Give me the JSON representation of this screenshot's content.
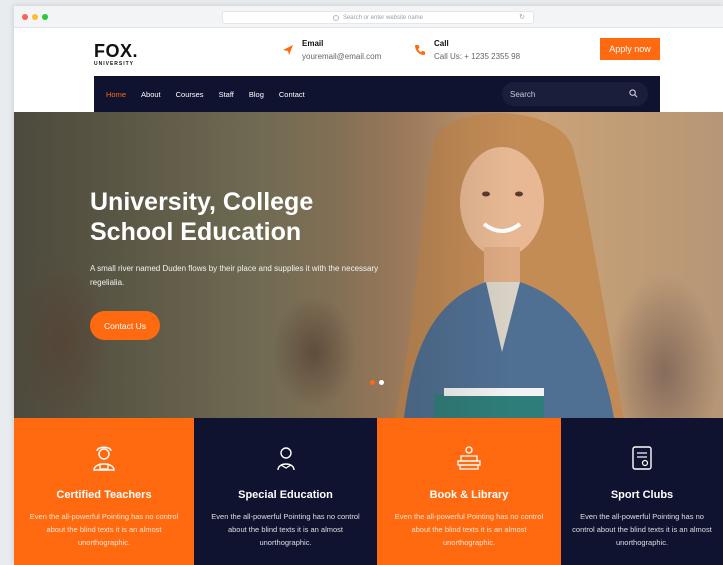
{
  "browser": {
    "url_placeholder": "Search or enter website name",
    "dot_colors": [
      "#ff5f57",
      "#febc2e",
      "#28c840"
    ]
  },
  "header": {
    "logo_main": "FOX.",
    "logo_sub": "UNIVERSITY",
    "email_title": "Email",
    "email_value": "youremail@email.com",
    "call_title": "Call",
    "call_value": "Call Us: + 1235 2355 98",
    "apply_label": "Apply now"
  },
  "nav": {
    "items": [
      {
        "label": "Home",
        "active": true
      },
      {
        "label": "About"
      },
      {
        "label": "Courses"
      },
      {
        "label": "Staff"
      },
      {
        "label": "Blog"
      },
      {
        "label": "Contact"
      }
    ],
    "search_placeholder": "Search"
  },
  "hero": {
    "title_line1": "University, College",
    "title_line2": "School Education",
    "text": "A small river named Duden flows by their place and supplies it with the necessary regelialia.",
    "button_label": "Contact Us"
  },
  "features": [
    {
      "icon": "teacher-icon",
      "title": "Certified Teachers",
      "text": "Even the all-powerful Pointing has no control about the blind texts it is an almost unorthographic."
    },
    {
      "icon": "student-icon",
      "title": "Special Education",
      "text": "Even the all-powerful Pointing has no control about the blind texts it is an almost unorthographic."
    },
    {
      "icon": "library-icon",
      "title": "Book & Library",
      "text": "Even the all-powerful Pointing has no control about the blind texts it is an almost unorthographic."
    },
    {
      "icon": "certificate-icon",
      "title": "Sport Clubs",
      "text": "Even the all-powerful Pointing has no control about the blind texts it is an almost unorthographic."
    }
  ],
  "colors": {
    "accent": "#ff6a10",
    "navy": "#0f1330"
  }
}
